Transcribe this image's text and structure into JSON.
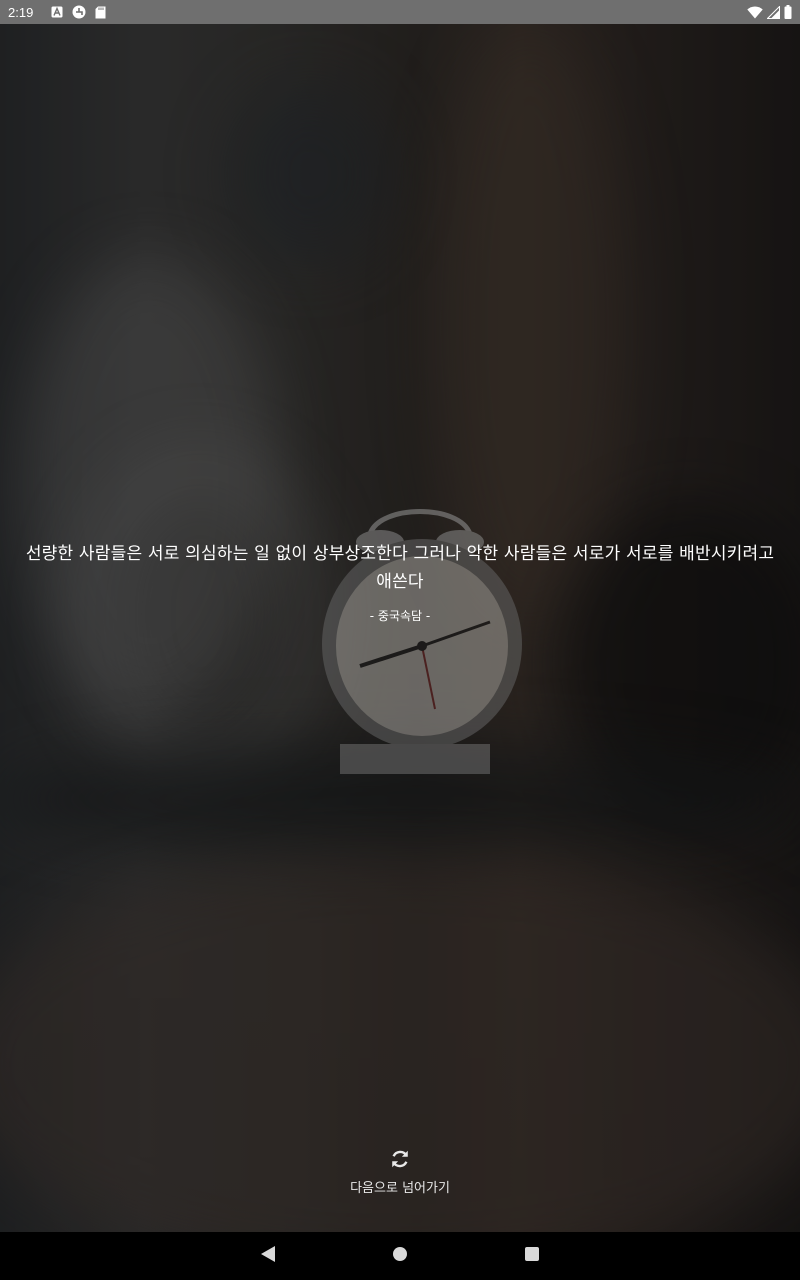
{
  "status_bar": {
    "time": "2:19",
    "left_icons": [
      "a-notification-icon",
      "pinwheel-icon",
      "sd-card-icon"
    ],
    "right_icons": [
      "wifi-icon",
      "cell-signal-icon",
      "battery-icon"
    ]
  },
  "quote": {
    "text": "선량한 사람들은 서로 의심하는 일 없이 상부상조한다 그러나 악한 사람들은 서로가 서로를 배반시키려고 애쓴다",
    "source": "- 중국속담 -"
  },
  "next": {
    "icon": "refresh-icon",
    "label": "다음으로 넘어가기"
  },
  "nav_bar": {
    "buttons": [
      "back-icon",
      "home-icon",
      "recents-icon"
    ]
  }
}
